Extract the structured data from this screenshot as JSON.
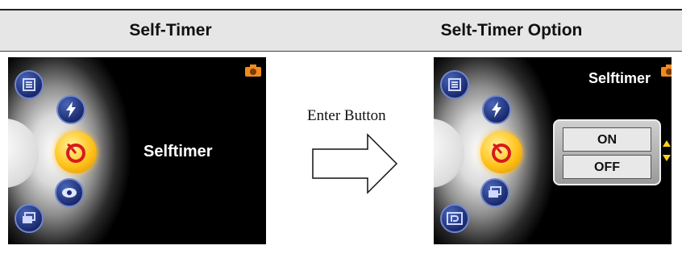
{
  "headers": {
    "left": "Self-Timer",
    "right": "Selt-Timer Option"
  },
  "left_screen": {
    "selected_label": "Selftimer",
    "icons": [
      "menu-list-icon",
      "flash-icon",
      "selftimer-icon",
      "eye-icon",
      "stack-icon",
      "camera-mode-icon"
    ]
  },
  "transition": {
    "label": "Enter Button"
  },
  "right_screen": {
    "panel_title": "Selftimer",
    "options": [
      "ON",
      "OFF"
    ],
    "icons": [
      "menu-list-icon",
      "flash-icon",
      "selftimer-icon",
      "stack-icon",
      "scene-icon",
      "camera-mode-icon"
    ]
  },
  "colors": {
    "highlight": "#ffc21a",
    "icon_blue": "#1b2a6e",
    "camera_orange": "#f08a1c",
    "arrow_yellow": "#ffd21a"
  }
}
